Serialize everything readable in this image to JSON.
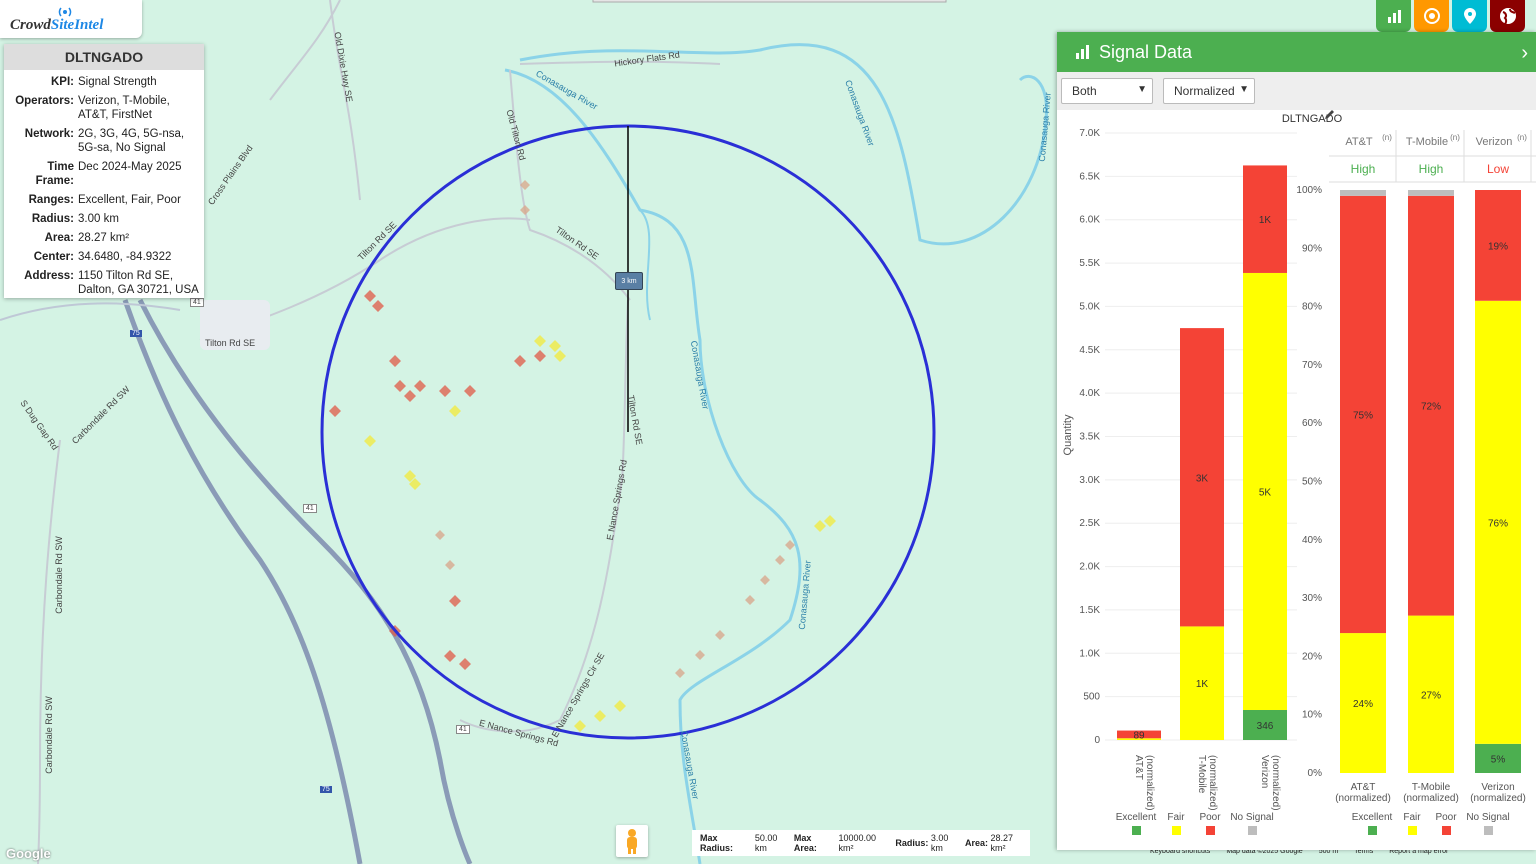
{
  "app": {
    "logo_part1": "Crowd",
    "logo_part2": "SiteIntel"
  },
  "site_info": {
    "title": "DLTNGADO",
    "rows": [
      {
        "key": "KPI:",
        "value": "Signal Strength"
      },
      {
        "key": "Operators:",
        "value": "Verizon, T-Mobile, AT&T, FirstNet"
      },
      {
        "key": "Network:",
        "value": "2G, 3G, 4G, 5G-nsa, 5G-sa, No Signal"
      },
      {
        "key": "Time Frame:",
        "value": "Dec 2024-May 2025"
      },
      {
        "key": "Ranges:",
        "value": "Excellent, Fair, Poor"
      },
      {
        "key": "Radius:",
        "value": "3.00 km"
      },
      {
        "key": "Area:",
        "value": "28.27 km²"
      },
      {
        "key": "Center:",
        "value": "34.6480, -84.9322"
      },
      {
        "key": "Address:",
        "value": "1150 Tilton Rd SE, Dalton, GA 30721, USA"
      }
    ]
  },
  "toolbar": {
    "buttons": [
      {
        "name": "chart-icon",
        "color": "#4caf50"
      },
      {
        "name": "target-icon",
        "color": "#ff9800"
      },
      {
        "name": "pin-icon",
        "color": "#00bcd4"
      },
      {
        "name": "globe-icon",
        "color": "#8b0000"
      }
    ]
  },
  "map": {
    "scale_marker": "3 km",
    "roads": [
      "Hickory Flats Rd",
      "Old Dixie Hwy SE",
      "Old Tilton Rd",
      "Tilton Rd SE",
      "Tilton Rd SE",
      "Tilton Rd SE",
      "Cross Plains Blvd",
      "Carbondale Rd SW",
      "S Dug Gap Rd",
      "Carbondale Rd SW",
      "E Nance Springs Rd",
      "Tilton Rd SE",
      "E Nance Springs Rd",
      "E Nance Springs Cir SE",
      "Carbondale Rd SW"
    ],
    "rivers": [
      "Conasauga River",
      "Conasauga River",
      "Conasauga River",
      "Conasauga River",
      "Conasauga River",
      "Conasauga River"
    ],
    "shields": [
      "41",
      "75",
      "41",
      "41",
      "75"
    ],
    "google": "Google",
    "stats_bar": {
      "max_radius_label": "Max Radius:",
      "max_radius": "50.00 km",
      "max_area_label": "Max Area:",
      "max_area": "10000.00 km²",
      "radius_label": "Radius:",
      "radius": "3.00 km",
      "area_label": "Area:",
      "area": "28.27 km²"
    },
    "footer": [
      "Keyboard shortcuts",
      "Map data ©2025 Google",
      "500 m",
      "Terms",
      "Report a map error"
    ]
  },
  "panel": {
    "title": "Signal Data",
    "filter_selected": "Both",
    "mode_selected": "Normalized",
    "chart_title": "DLTNGADO",
    "operator_tabs": [
      {
        "label": "AT&T",
        "sup": "(n)",
        "rating": "High",
        "rating_color": "#4caf50"
      },
      {
        "label": "T-Mobile",
        "sup": "(n)",
        "rating": "High",
        "rating_color": "#4caf50"
      },
      {
        "label": "Verizon",
        "sup": "(n)",
        "rating": "Low",
        "rating_color": "#f44336"
      }
    ],
    "y_axis_label": "Quantity",
    "legend": [
      "Excellent",
      "Fair",
      "Poor",
      "No Signal"
    ],
    "colors": {
      "Excellent": "#4caf50",
      "Fair": "#ffff00",
      "Poor": "#f44336",
      "No Signal": "#bdbdbd"
    }
  },
  "chart_data": [
    {
      "type": "bar",
      "stacked": true,
      "title": "DLTNGADO",
      "ylabel": "Quantity",
      "ylim": [
        0,
        7000
      ],
      "yticks": [
        "0",
        "500",
        "1.0K",
        "1.5K",
        "2.0K",
        "2.5K",
        "3.0K",
        "3.5K",
        "4.0K",
        "4.5K",
        "5.0K",
        "5.5K",
        "6.0K",
        "6.5K",
        "7.0K"
      ],
      "categories": [
        "AT&T (normalized)",
        "T-Mobile (normalized)",
        "Verizon (normalized)"
      ],
      "series": [
        {
          "name": "Excellent",
          "values": [
            0,
            0,
            346
          ],
          "labels": [
            "",
            "",
            "346"
          ]
        },
        {
          "name": "Fair",
          "values": [
            20,
            1310,
            5040
          ],
          "labels": [
            "",
            "1K",
            "5K"
          ]
        },
        {
          "name": "Poor",
          "values": [
            89,
            3440,
            1240
          ],
          "labels": [
            "89",
            "3K",
            "1K"
          ]
        },
        {
          "name": "No Signal",
          "values": [
            0,
            0,
            0
          ],
          "labels": [
            "",
            "",
            ""
          ]
        }
      ]
    },
    {
      "type": "bar",
      "stacked": true,
      "ylim": [
        0,
        100
      ],
      "yticks": [
        "0%",
        "10%",
        "20%",
        "30%",
        "40%",
        "50%",
        "60%",
        "70%",
        "80%",
        "90%",
        "100%"
      ],
      "categories": [
        "AT&T (normalized)",
        "T-Mobile (normalized)",
        "Verizon (normalized)"
      ],
      "series": [
        {
          "name": "Excellent",
          "values": [
            0,
            0,
            5
          ],
          "labels": [
            "",
            "",
            "5%"
          ]
        },
        {
          "name": "Fair",
          "values": [
            24,
            27,
            76
          ],
          "labels": [
            "24%",
            "27%",
            "76%"
          ]
        },
        {
          "name": "Poor",
          "values": [
            75,
            72,
            19
          ],
          "labels": [
            "75%",
            "72%",
            "19%"
          ]
        },
        {
          "name": "No Signal",
          "values": [
            1,
            1,
            0
          ],
          "labels": [
            "",
            "",
            ""
          ]
        }
      ]
    }
  ]
}
